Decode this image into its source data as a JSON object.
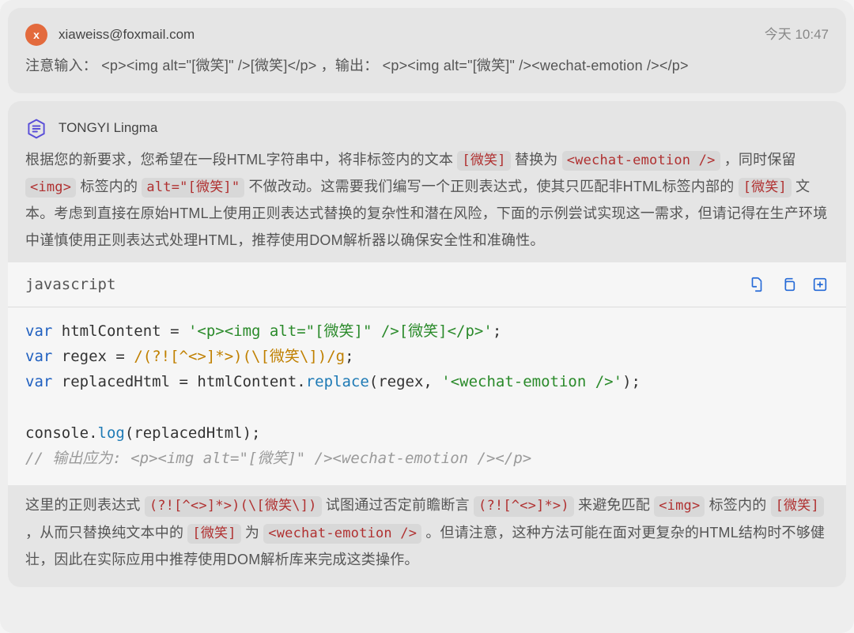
{
  "user": {
    "avatar_letter": "x",
    "email": "xiaweiss@foxmail.com",
    "timestamp": "今天 10:47",
    "prefix": "注意输入：",
    "input_code": "<p><img alt=\"[微笑]\" />[微笑]</p>",
    "mid": "，输出：",
    "output_code": "<p><img alt=\"[微笑]\" /><wechat-emotion /></p>"
  },
  "assistant": {
    "name": "TONGYI Lingma",
    "para1": {
      "t1": "根据您的新要求，您希望在一段HTML字符串中，将非标签内的文本 ",
      "c1": "[微笑]",
      "t2": " 替换为 ",
      "c2": "<wechat-emotion />",
      "t3": " ，同时保留 ",
      "c3": "<img>",
      "t4": " 标签内的 ",
      "c4": "alt=\"[微笑]\"",
      "t5": " 不做改动。这需要我们编写一个正则表达式，使其只匹配非HTML标签内部的 ",
      "c5": "[微笑]",
      "t6": " 文本。考虑到直接在原始HTML上使用正则表达式替换的复杂性和潜在风险，下面的示例尝试实现这一需求，但请记得在生产环境中谨慎使用正则表达式处理HTML，推荐使用DOM解析器以确保安全性和准确性。"
    },
    "codeblock": {
      "language": "javascript",
      "code": {
        "l1": {
          "kw": "var",
          "id": "htmlContent",
          "eq": " = ",
          "str": "'<p><img alt=\"[微笑]\" />[微笑]</p>'",
          "end": ";"
        },
        "l2": {
          "kw": "var",
          "id": "regex",
          "eq": " = ",
          "re": "/(?![^<>]*>)(\\[微笑\\])/g",
          "end": ";"
        },
        "l3": {
          "kw": "var",
          "id": "replacedHtml",
          "eq": " = ",
          "obj": "htmlContent",
          "dot": ".",
          "fn": "replace",
          "args_pre": "(regex, ",
          "str": "'<wechat-emotion />'",
          "args_post": ");"
        },
        "l5": {
          "obj": "console",
          "dot": ".",
          "fn": "log",
          "args": "(replacedHtml);"
        },
        "l6": {
          "cm": "// 输出应为: <p><img alt=\"[微笑]\" /><wechat-emotion /></p>"
        }
      }
    },
    "para2": {
      "t1": "这里的正则表达式 ",
      "c1": "(?![^<>]*>)(\\[微笑\\])",
      "t2": " 试图通过否定前瞻断言 ",
      "c2": "(?![^<>]*>)",
      "t3": " 来避免匹配 ",
      "c3": "<img>",
      "t4": " 标签内的 ",
      "c4": "[微笑]",
      "t5": " ，从而只替换纯文本中的 ",
      "c5": "[微笑]",
      "t6": " 为 ",
      "c6": "<wechat-emotion />",
      "t7": " 。但请注意，这种方法可能在面对更复杂的HTML结构时不够健壮，因此在实际应用中推荐使用DOM解析库来完成这类操作。"
    }
  }
}
